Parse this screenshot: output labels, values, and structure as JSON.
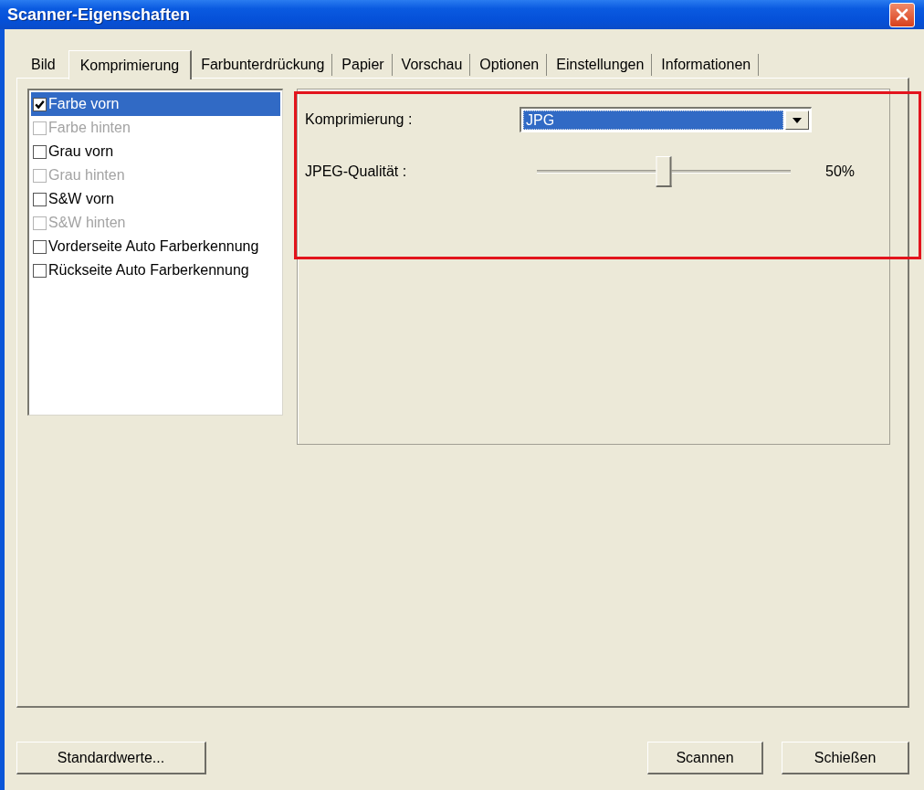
{
  "window": {
    "title": "Scanner-Eigenschaften"
  },
  "tabs": [
    {
      "label": "Bild",
      "selected": false
    },
    {
      "label": "Komprimierung",
      "selected": true
    },
    {
      "label": "Farbunterdrückung",
      "selected": false
    },
    {
      "label": "Papier",
      "selected": false
    },
    {
      "label": "Vorschau",
      "selected": false
    },
    {
      "label": "Optionen",
      "selected": false
    },
    {
      "label": "Einstellungen",
      "selected": false
    },
    {
      "label": "Informationen",
      "selected": false
    }
  ],
  "image_list": {
    "items": [
      {
        "label": "Farbe vorn",
        "checked": true,
        "disabled": false,
        "selected": true
      },
      {
        "label": "Farbe hinten",
        "checked": false,
        "disabled": true,
        "selected": false
      },
      {
        "label": "Grau vorn",
        "checked": false,
        "disabled": false,
        "selected": false
      },
      {
        "label": "Grau hinten",
        "checked": false,
        "disabled": true,
        "selected": false
      },
      {
        "label": "S&W vorn",
        "checked": false,
        "disabled": false,
        "selected": false
      },
      {
        "label": "S&W hinten",
        "checked": false,
        "disabled": true,
        "selected": false
      },
      {
        "label": "Vorderseite Auto Farberkennung",
        "checked": false,
        "disabled": false,
        "selected": false
      },
      {
        "label": "Rückseite Auto Farberkennung",
        "checked": false,
        "disabled": false,
        "selected": false
      }
    ]
  },
  "compression": {
    "label": "Komprimierung :",
    "value": "JPG"
  },
  "quality": {
    "label": "JPEG-Qualität :",
    "level": 0.5,
    "reading": "50%"
  },
  "footer": {
    "reset_button": "Standardwerte...",
    "action_buttons": [
      "Scannen",
      "Schießen"
    ]
  }
}
